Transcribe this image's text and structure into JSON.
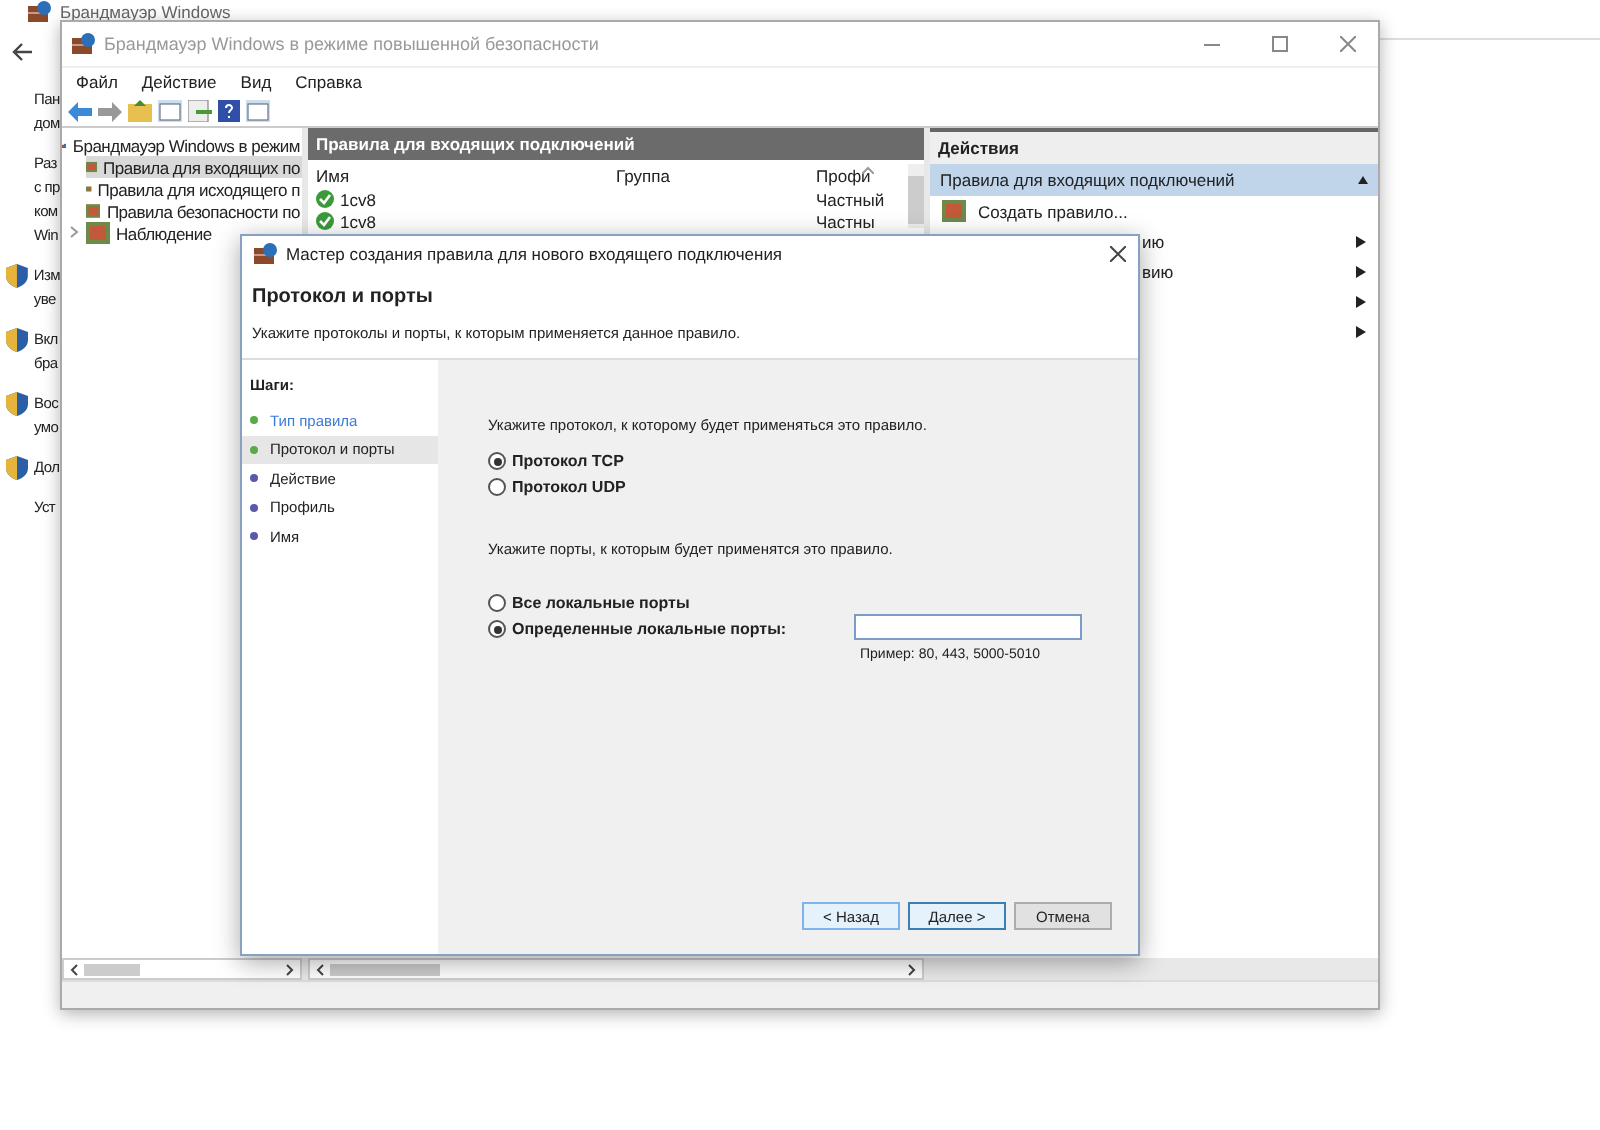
{
  "background_window": {
    "title": "Брандмауэр Windows",
    "fragments": [
      {
        "kind": "text",
        "lines": [
          "Пан",
          "дом"
        ]
      },
      {
        "kind": "text",
        "lines": [
          "Раз",
          "с пр",
          "ком",
          "Win"
        ]
      },
      {
        "kind": "shield",
        "lines": [
          "Изм",
          "уве"
        ]
      },
      {
        "kind": "shield",
        "lines": [
          "Вкл",
          "бра"
        ]
      },
      {
        "kind": "shield",
        "lines": [
          "Вос",
          "умо"
        ]
      },
      {
        "kind": "shield",
        "lines": [
          "Дол"
        ]
      },
      {
        "kind": "text",
        "lines": [
          "Уст"
        ]
      }
    ]
  },
  "main_window": {
    "title": "Брандмауэр Windows в режиме повышенной безопасности",
    "menu": [
      "Файл",
      "Действие",
      "Вид",
      "Справка"
    ],
    "tree": [
      {
        "label": "Брандмауэр Windows в режим",
        "selected": false,
        "children": [
          {
            "label": "Правила для входящих по",
            "selected": true
          },
          {
            "label": "Правила для исходящего п",
            "selected": false
          },
          {
            "label": "Правила безопасности по",
            "selected": false
          },
          {
            "label": "Наблюдение",
            "selected": false,
            "expanded": false
          }
        ]
      }
    ],
    "rules": {
      "title": "Правила для входящих подключений",
      "columns": [
        "Имя",
        "Группа",
        "Профи"
      ],
      "rows": [
        {
          "name": "1cv8",
          "enabled": true,
          "profile": "Частный"
        },
        {
          "name": "1cv8",
          "enabled": true,
          "profile": "Частны"
        }
      ]
    },
    "actions": {
      "title": "Действия",
      "section": {
        "label": "Правила для входящих подключений",
        "expanded": true
      },
      "items": [
        {
          "kind": "command",
          "label": "Создать правило..."
        },
        {
          "kind": "submenu",
          "label": "ию"
        },
        {
          "kind": "submenu",
          "label": "вию"
        },
        {
          "kind": "submenu"
        },
        {
          "kind": "submenu"
        }
      ]
    }
  },
  "wizard": {
    "title": "Мастер создания правила для нового входящего подключения",
    "heading": "Протокол и порты",
    "subheading": "Укажите протоколы и порты, к которым применяется данное правило.",
    "steps_title": "Шаги:",
    "steps": [
      {
        "label": "Тип правила",
        "done": true,
        "selected": false
      },
      {
        "label": "Протокол и порты",
        "done": true,
        "selected": true
      },
      {
        "label": "Действие",
        "done": false,
        "selected": false
      },
      {
        "label": "Профиль",
        "done": false,
        "selected": false
      },
      {
        "label": "Имя",
        "done": false,
        "selected": false
      }
    ],
    "protocol_prompt": "Укажите протокол, к которому будет применяться это правило.",
    "protocols": [
      {
        "label": "Протокол TCP",
        "selected": true
      },
      {
        "label": "Протокол UDP",
        "selected": false
      }
    ],
    "ports_prompt": "Укажите порты, к которым будет применятся это правило.",
    "port_options": [
      {
        "label": "Все локальные порты",
        "selected": false
      },
      {
        "label": "Определенные локальные порты:",
        "selected": true
      }
    ],
    "ports_hint": "Пример: 80, 443, 5000-5010",
    "buttons": [
      {
        "label": "< Назад",
        "kind": "back"
      },
      {
        "label": "Далее >",
        "kind": "default"
      },
      {
        "label": "Отмена",
        "kind": "cancel"
      }
    ]
  }
}
